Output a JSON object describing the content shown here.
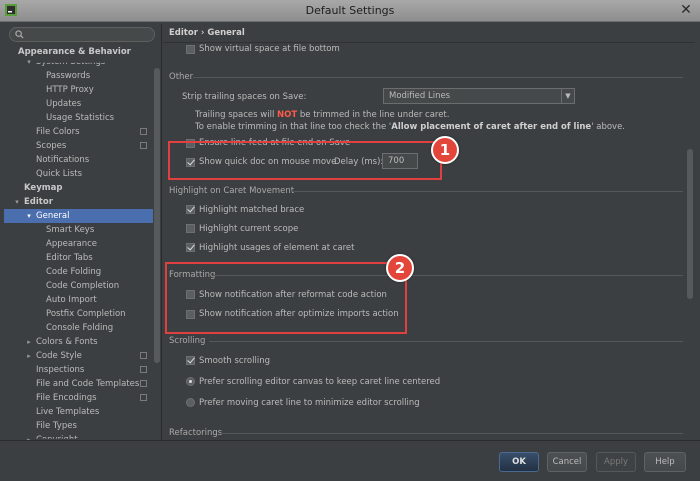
{
  "window": {
    "title": "Default Settings"
  },
  "sidebar": {
    "search_placeholder": "",
    "items": [
      {
        "label": "Appearance & Behavior",
        "bold": true
      },
      {
        "label": "System Settings",
        "indent": 2,
        "arrow": "▾",
        "partial": true
      },
      {
        "label": "Passwords",
        "indent": 3
      },
      {
        "label": "HTTP Proxy",
        "indent": 3
      },
      {
        "label": "Updates",
        "indent": 3
      },
      {
        "label": "Usage Statistics",
        "indent": 3
      },
      {
        "label": "File Colors",
        "indent": 2,
        "config": true
      },
      {
        "label": "Scopes",
        "indent": 2,
        "config": true
      },
      {
        "label": "Notifications",
        "indent": 2
      },
      {
        "label": "Quick Lists",
        "indent": 2
      },
      {
        "label": "Keymap",
        "bold": true,
        "indent": 1
      },
      {
        "label": "Editor",
        "bold": true,
        "indent": 1,
        "arrow": "▾"
      },
      {
        "label": "General",
        "indent": 2,
        "arrow": "▾",
        "selected": true
      },
      {
        "label": "Smart Keys",
        "indent": 3
      },
      {
        "label": "Appearance",
        "indent": 3
      },
      {
        "label": "Editor Tabs",
        "indent": 3
      },
      {
        "label": "Code Folding",
        "indent": 3
      },
      {
        "label": "Code Completion",
        "indent": 3
      },
      {
        "label": "Auto Import",
        "indent": 3
      },
      {
        "label": "Postfix Completion",
        "indent": 3
      },
      {
        "label": "Console Folding",
        "indent": 3
      },
      {
        "label": "Colors & Fonts",
        "indent": 2,
        "arrow": "▸"
      },
      {
        "label": "Code Style",
        "indent": 2,
        "arrow": "▸",
        "config": true
      },
      {
        "label": "Inspections",
        "indent": 2,
        "config": true
      },
      {
        "label": "File and Code Templates",
        "indent": 2,
        "config": true
      },
      {
        "label": "File Encodings",
        "indent": 2,
        "config": true
      },
      {
        "label": "Live Templates",
        "indent": 2
      },
      {
        "label": "File Types",
        "indent": 2
      },
      {
        "label": "Copyright",
        "indent": 2,
        "arrow": "▸",
        "partial": true
      }
    ]
  },
  "main": {
    "breadcrumb": {
      "parent": "Editor",
      "separator": "›",
      "current": "General"
    },
    "show_virtual_space": "Show virtual space at file bottom",
    "other": {
      "section": "Other",
      "strip_label": "Strip trailing spaces on Save:",
      "strip_value": "Modified Lines",
      "note_line1_pre": "Trailing spaces will ",
      "note_line1_warn": "NOT",
      "note_line1_post": " be trimmed in the line under caret.",
      "note_line2_pre": "To enable trimming in that line too check the '",
      "note_line2_bold": "Allow placement of caret after end of line",
      "note_line2_post": "' above.",
      "ensure_line_feed": "Ensure line feed at file end on Save",
      "quick_doc": "Show quick doc on mouse move",
      "delay_label": "Delay (ms):",
      "delay_value": "700"
    },
    "caret": {
      "section": "Highlight on Caret Movement",
      "matched_brace": "Highlight matched brace",
      "current_scope": "Highlight current scope",
      "usages": "Highlight usages of element at caret"
    },
    "formatting": {
      "section": "Formatting",
      "after_reformat": "Show notification after reformat code action",
      "after_optimize": "Show notification after optimize imports action"
    },
    "scrolling": {
      "section": "Scrolling",
      "smooth": "Smooth scrolling",
      "prefer_canvas": "Prefer scrolling editor canvas to keep caret line centered",
      "prefer_caret": "Prefer moving caret line to minimize editor scrolling"
    },
    "refactorings": {
      "section": "Refactorings"
    }
  },
  "annotations": {
    "one": "1",
    "two": "2"
  },
  "footer": {
    "ok": "OK",
    "cancel": "Cancel",
    "apply": "Apply",
    "help": "Help"
  },
  "colors": {
    "selection": "#4b6eaf",
    "callout": "#e3453a",
    "warning": "#ff5a4a"
  }
}
